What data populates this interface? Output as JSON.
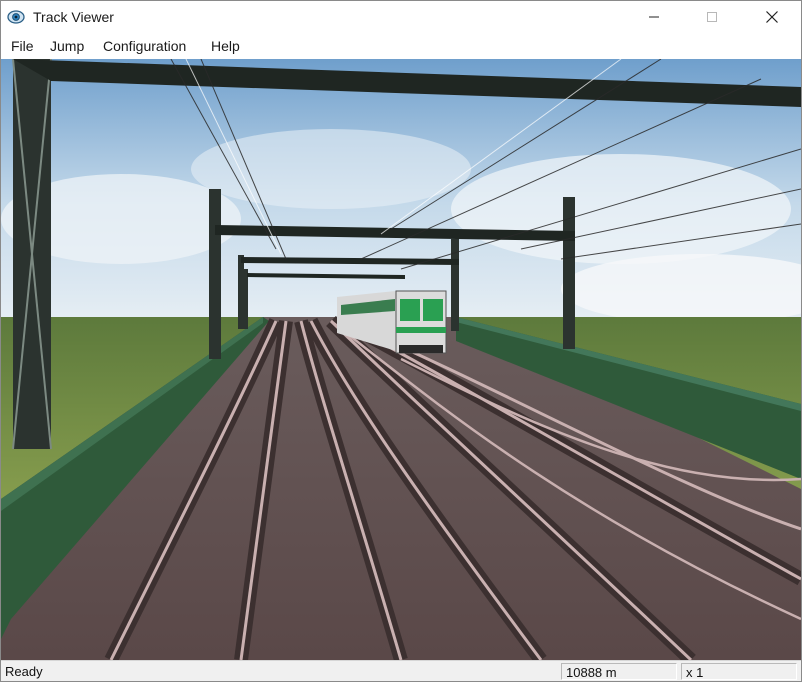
{
  "window": {
    "title": "Track Viewer",
    "icon": "app-eye-icon",
    "controls": {
      "minimize": "minimize-icon",
      "maximize": "maximize-icon",
      "close": "close-icon"
    }
  },
  "menu": {
    "file": "File",
    "jump": "Jump",
    "configuration": "Configuration",
    "help": "Help"
  },
  "scene": {
    "description_icon": "3d-track-view",
    "train_color": "#2aa052"
  },
  "status": {
    "message": "Ready",
    "distance": "10888 m",
    "speed": "x 1"
  }
}
